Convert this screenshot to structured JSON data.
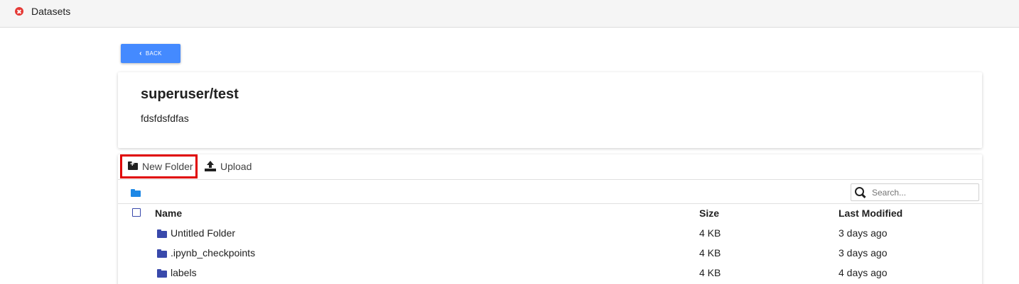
{
  "topbar": {
    "title": "Datasets",
    "close_icon": "close-circle-icon",
    "close_color": "#e53935"
  },
  "back_button": {
    "label": "BACK",
    "icon": "chevron-left-icon",
    "color": "#448aff"
  },
  "dataset": {
    "title": "superuser/test",
    "description": "fdsfdsfdfas"
  },
  "toolbar": {
    "new_folder_label": "New Folder",
    "new_folder_icon": "folder-plus-icon",
    "upload_label": "Upload",
    "upload_icon": "upload-icon",
    "highlight_color": "#e00000"
  },
  "pathbar": {
    "root_icon": "folder-icon",
    "root_icon_color": "#1e88e5"
  },
  "search": {
    "placeholder": "Search...",
    "icon": "search-icon"
  },
  "table": {
    "headers": {
      "name": "Name",
      "size": "Size",
      "modified": "Last Modified"
    },
    "rows": [
      {
        "name": "Untitled Folder",
        "size": "4 KB",
        "modified": "3 days ago",
        "icon": "folder-icon"
      },
      {
        "name": ".ipynb_checkpoints",
        "size": "4 KB",
        "modified": "3 days ago",
        "icon": "folder-icon"
      },
      {
        "name": "labels",
        "size": "4 KB",
        "modified": "4 days ago",
        "icon": "folder-icon"
      }
    ],
    "folder_icon_color": "#3949ab"
  }
}
